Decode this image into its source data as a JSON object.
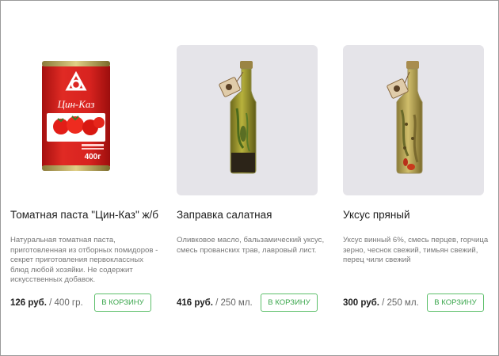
{
  "products": [
    {
      "title": "Томатная паста \"Цин-Каз\" ж/б",
      "description": "Натуральная томатная паста, приготовленная из отборных помидоров - секрет приготовления первоклассных блюд любой хозяйки. Не содержит искусственных добавок.",
      "price": "126 руб.",
      "unit": " / 400 гр.",
      "button_label": "В КОРЗИНУ",
      "can_brand": "Цин-Каз",
      "can_weight": "400г"
    },
    {
      "title": "Заправка салатная",
      "description": "Оливковое масло, бальзамический уксус, смесь прованских трав, лавровый лист.",
      "price": "416 руб.",
      "unit": " / 250 мл.",
      "button_label": "В КОРЗИНУ"
    },
    {
      "title": "Уксус пряный",
      "description": "Уксус винный 6%, смесь перцев, горчица зерно, чеснок свежий, тимьян свежий, перец чили свежий",
      "price": "300 руб.",
      "unit": " / 250 мл.",
      "button_label": "В КОРЗИНУ"
    }
  ],
  "colors": {
    "accent_green": "#5cbf6a",
    "image_bg": "#e5e4e9",
    "can_red": "#d8231f"
  }
}
